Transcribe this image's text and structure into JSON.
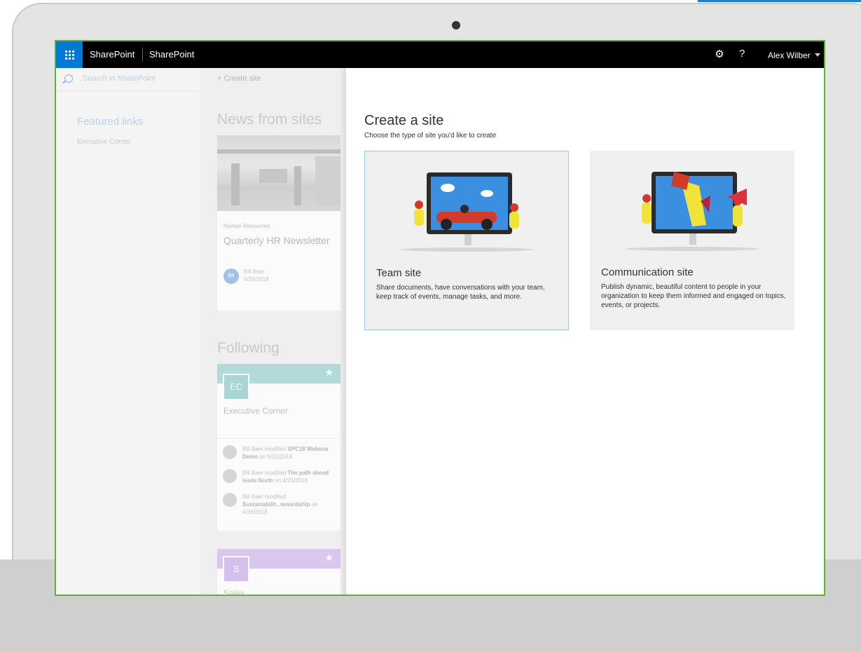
{
  "topbar": {
    "app_name": "SharePoint",
    "site_name": "SharePoint",
    "help_label": "?",
    "user_name": "Alex Wilber"
  },
  "leftnav": {
    "search_placeholder": "Search in SharePoint",
    "featured_heading": "Featured links",
    "links": [
      "Executive Corner"
    ]
  },
  "center": {
    "create_site_label": "+ Create site",
    "news_heading": "News from sites",
    "news": {
      "category": "Human Resources",
      "headline": "Quarterly HR Newsletter",
      "author_initials": "BB",
      "author": "Bill Baer",
      "date": "4/26/2018"
    },
    "following_heading": "Following",
    "following": [
      {
        "initials": "EC",
        "name": "Executive Corner",
        "banner_color": "#b3dada",
        "activity": [
          {
            "prefix": "Bill Baer modified ",
            "item": "SPC18 Webinar Demo",
            "suffix": " on 5/22/2018"
          },
          {
            "prefix": "Bill Baer modified ",
            "item": "The path ahead leads North",
            "suffix": " on 4/26/2018"
          },
          {
            "prefix": "Bill Baer modified ",
            "item": "Sustainabilit...tewardship",
            "suffix": " on 4/26/2018"
          }
        ]
      },
      {
        "initials": "S",
        "name": "Sales",
        "banner_color": "#d9c7f0"
      }
    ]
  },
  "panel": {
    "title": "Create a site",
    "subtitle": "Choose the type of site you'd like to create",
    "options": [
      {
        "title": "Team site",
        "description": "Share documents, have conversations with your team, keep track of events, manage tasks, and more."
      },
      {
        "title": "Communication site",
        "description": "Publish dynamic, beautiful content to people in your organization to keep them informed and engaged on topics, events, or projects."
      }
    ]
  },
  "colors": {
    "suite_bar": "#000000",
    "waffle": "#0078d7",
    "frame_border": "#5bb332",
    "selected_border": "#9cc3e8"
  },
  "icons": [
    "waffle-icon",
    "gear-icon",
    "help-icon",
    "chevron-down-icon",
    "search-icon",
    "plus-icon",
    "star-icon"
  ]
}
